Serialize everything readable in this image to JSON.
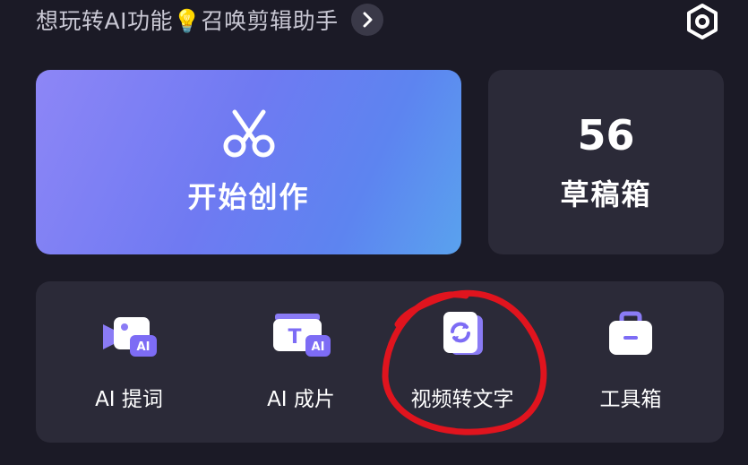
{
  "promo": {
    "text": "想玩转AI功能💡召唤剪辑助手",
    "chevron_icon": "chevron-right-icon"
  },
  "header": {
    "settings_icon": "hexagon-settings-icon"
  },
  "create_card": {
    "label": "开始创作",
    "icon": "scissors-icon",
    "gradient": [
      "#8d86f6",
      "#5aa2ee"
    ]
  },
  "drafts_card": {
    "count": "56",
    "label": "草稿箱"
  },
  "tools": [
    {
      "label": "AI 提词",
      "icon": "ai-teleprompter-icon"
    },
    {
      "label": "AI 成片",
      "icon": "ai-auto-video-icon"
    },
    {
      "label": "视频转文字",
      "icon": "video-to-text-icon"
    },
    {
      "label": "工具箱",
      "icon": "toolbox-icon"
    }
  ],
  "colors": {
    "background": "#1b1a26",
    "card": "#2b2a38",
    "annotation": "#e0141e",
    "icon_accent": "#7d6cf5"
  }
}
